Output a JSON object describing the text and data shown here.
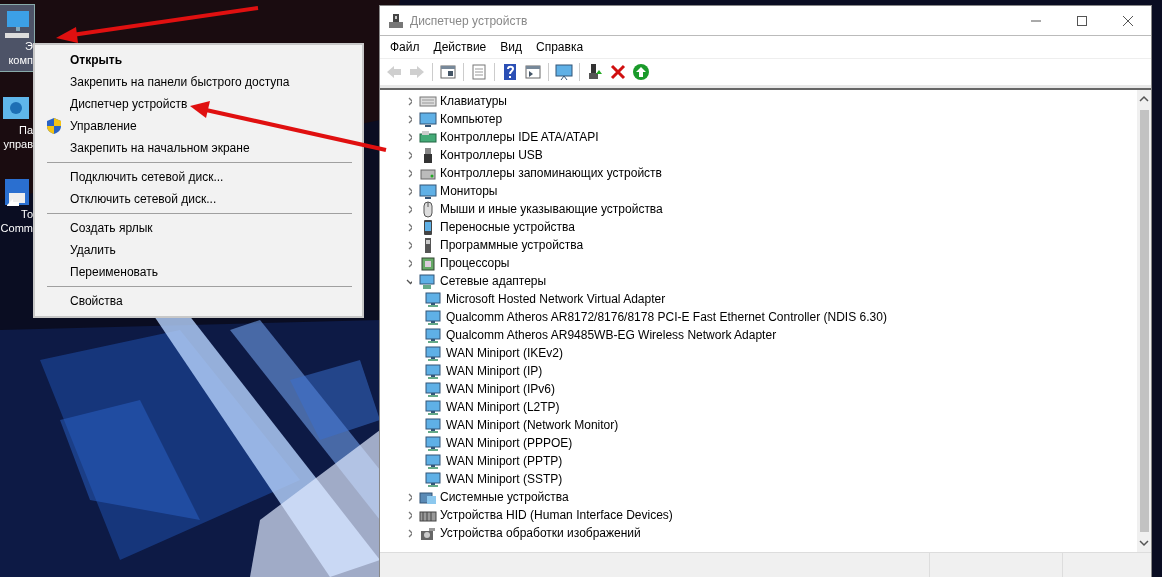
{
  "desktop": {
    "icons": [
      {
        "label_lines": [
          "Э",
          "комп"
        ],
        "selected": true
      },
      {
        "label_lines": [
          "Па",
          "управ"
        ],
        "selected": false
      },
      {
        "label_lines": [
          "То",
          "Comm"
        ],
        "selected": false
      }
    ]
  },
  "context_menu": {
    "groups": [
      [
        {
          "label": "Открыть",
          "default": true,
          "elevated": false
        },
        {
          "label": "Закрепить на панели быстрого доступа",
          "default": false,
          "elevated": false
        },
        {
          "label": "Диспетчер устройств",
          "default": false,
          "elevated": false
        },
        {
          "label": "Управление",
          "default": false,
          "elevated": true
        },
        {
          "label": "Закрепить на начальном экране",
          "default": false,
          "elevated": false
        }
      ],
      [
        {
          "label": "Подключить сетевой диск...",
          "default": false,
          "elevated": false
        },
        {
          "label": "Отключить сетевой диск...",
          "default": false,
          "elevated": false
        }
      ],
      [
        {
          "label": "Создать ярлык",
          "default": false,
          "elevated": false
        },
        {
          "label": "Удалить",
          "default": false,
          "elevated": false
        },
        {
          "label": "Переименовать",
          "default": false,
          "elevated": false
        }
      ],
      [
        {
          "label": "Свойства",
          "default": false,
          "elevated": false
        }
      ]
    ]
  },
  "window": {
    "title": "Диспетчер устройств",
    "menu": [
      "Файл",
      "Действие",
      "Вид",
      "Справка"
    ],
    "toolbar": [
      {
        "disabled": true
      },
      {
        "disabled": true
      },
      {
        "disabled": false
      },
      {
        "disabled": false
      },
      {
        "disabled": false
      },
      {
        "disabled": false
      },
      {
        "disabled": false
      },
      {
        "disabled": false
      },
      {
        "disabled": false
      },
      {
        "disabled": false
      }
    ],
    "tree": [
      {
        "label": "Клавиатуры",
        "expanded": false
      },
      {
        "label": "Компьютер",
        "expanded": false
      },
      {
        "label": "Контроллеры IDE ATA/ATAPI",
        "expanded": false
      },
      {
        "label": "Контроллеры USB",
        "expanded": false
      },
      {
        "label": "Контроллеры запоминающих устройств",
        "expanded": false
      },
      {
        "label": "Мониторы",
        "expanded": false
      },
      {
        "label": "Мыши и иные указывающие устройства",
        "expanded": false
      },
      {
        "label": "Переносные устройства",
        "expanded": false
      },
      {
        "label": "Программные устройства",
        "expanded": false
      },
      {
        "label": "Процессоры",
        "expanded": false
      },
      {
        "label": "Сетевые адаптеры",
        "expanded": true,
        "children": [
          {
            "label": "Microsoft Hosted Network Virtual Adapter"
          },
          {
            "label": "Qualcomm Atheros AR8172/8176/8178 PCI-E Fast Ethernet Controller (NDIS 6.30)"
          },
          {
            "label": "Qualcomm Atheros AR9485WB-EG Wireless Network Adapter"
          },
          {
            "label": "WAN Miniport (IKEv2)"
          },
          {
            "label": "WAN Miniport (IP)"
          },
          {
            "label": "WAN Miniport (IPv6)"
          },
          {
            "label": "WAN Miniport (L2TP)"
          },
          {
            "label": "WAN Miniport (Network Monitor)"
          },
          {
            "label": "WAN Miniport (PPPOE)"
          },
          {
            "label": "WAN Miniport (PPTP)"
          },
          {
            "label": "WAN Miniport (SSTP)"
          }
        ]
      },
      {
        "label": "Системные устройства",
        "expanded": false
      },
      {
        "label": "Устройства HID (Human Interface Devices)",
        "expanded": false
      },
      {
        "label": "Устройства обработки изображений",
        "expanded": false
      }
    ]
  }
}
